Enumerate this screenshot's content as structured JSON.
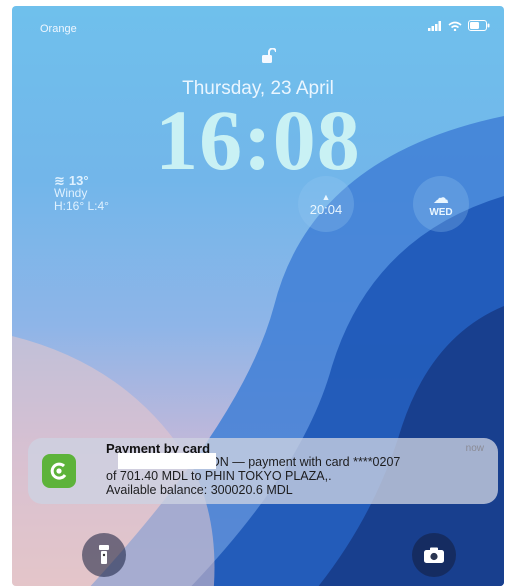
{
  "status_bar": {
    "carrier": "Orange"
  },
  "lock_screen": {
    "date": "Thursday, 23 April",
    "time": "16:08"
  },
  "weather": {
    "temp": "13°",
    "condition": "Windy",
    "high_low": "H:16° L:4°"
  },
  "widgets": {
    "sunset_time": "20:04",
    "forecast_day": "WED"
  },
  "notification": {
    "title": "Payment by card",
    "time": "now",
    "line1": "ON — payment with card ****0207",
    "line2": "of 701.40 MDL to PHIN TOKYO PLAZA,.",
    "line3": "Available balance: 300020.6 MDL"
  },
  "colors": {
    "time_color": "#c9f1f4",
    "app_icon": "#5db33a"
  }
}
